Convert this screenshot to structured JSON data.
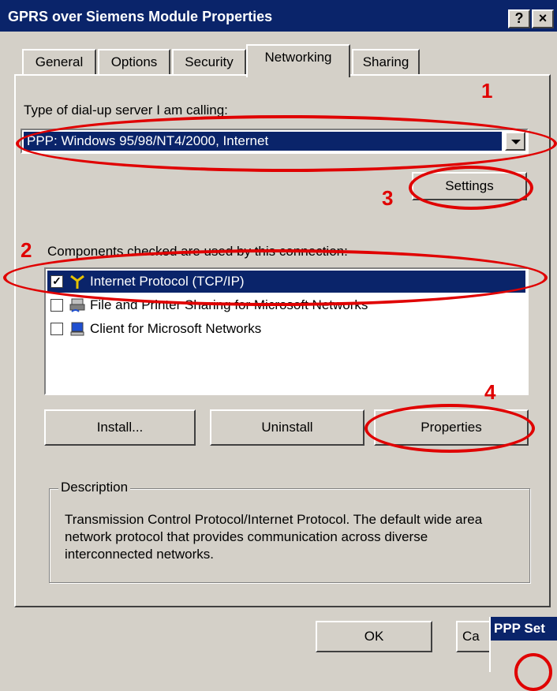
{
  "window": {
    "title": "GPRS over Siemens Module Properties",
    "help_button": "?",
    "close_button": "×"
  },
  "tabs": [
    {
      "label": "General",
      "active": false
    },
    {
      "label": "Options",
      "active": false
    },
    {
      "label": "Security",
      "active": false
    },
    {
      "label": "Networking",
      "active": true
    },
    {
      "label": "Sharing",
      "active": false
    }
  ],
  "networking": {
    "server_type_label": "Type of dial-up server I am calling:",
    "server_type_value": "PPP: Windows 95/98/NT4/2000, Internet",
    "settings_button": "Settings",
    "components_label": "Components checked are used by this connection:",
    "components": [
      {
        "label": "Internet Protocol (TCP/IP)",
        "checked": true,
        "selected": true,
        "icon": "network-protocol-icon"
      },
      {
        "label": "File and Printer Sharing for Microsoft Networks",
        "checked": false,
        "selected": false,
        "icon": "printer-share-icon"
      },
      {
        "label": "Client for Microsoft Networks",
        "checked": false,
        "selected": false,
        "icon": "computer-icon"
      }
    ],
    "install_button": "Install...",
    "uninstall_button": "Uninstall",
    "properties_button": "Properties",
    "description_title": "Description",
    "description_text": "Transmission Control Protocol/Internet Protocol. The default wide area network protocol that provides communication across diverse interconnected networks."
  },
  "footer": {
    "ok_button": "OK",
    "cancel_button_partial": "Ca"
  },
  "overlay_window": {
    "title_partial": "PPP Set"
  },
  "annotations": {
    "color": "#e00000",
    "numbers": [
      "1",
      "2",
      "3",
      "4"
    ]
  },
  "colors": {
    "titlebar": "#0a246a",
    "face": "#d4d0c8",
    "selection": "#0a246a"
  }
}
